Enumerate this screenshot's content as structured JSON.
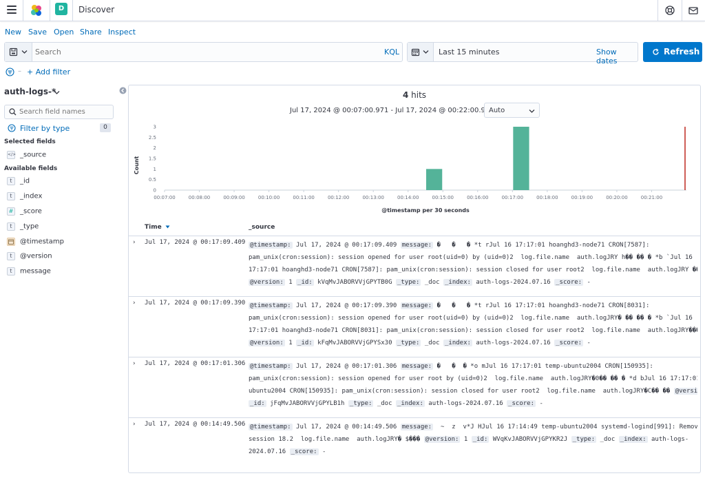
{
  "header": {
    "space_initial": "D",
    "app_title": "Discover"
  },
  "menu": {
    "items": [
      "New",
      "Save",
      "Open",
      "Share",
      "Inspect"
    ]
  },
  "query": {
    "placeholder": "Search",
    "language": "KQL"
  },
  "time": {
    "range": "Last 15 minutes",
    "show_dates": "Show dates",
    "refresh": "Refresh"
  },
  "filters": {
    "add": "+ Add filter"
  },
  "sidebar": {
    "index_pattern": "auth-logs-*",
    "search_placeholder": "Search field names",
    "filter_by_type": "Filter by type",
    "filter_count": "0",
    "selected_label": "Selected fields",
    "selected_fields": [
      {
        "type": "</>",
        "name": "_source"
      }
    ],
    "available_label": "Available fields",
    "available_fields": [
      {
        "type": "t",
        "name": "_id"
      },
      {
        "type": "t",
        "name": "_index"
      },
      {
        "type": "#",
        "name": "_score"
      },
      {
        "type": "t",
        "name": "_type"
      },
      {
        "type": "cal",
        "name": "@timestamp"
      },
      {
        "type": "t",
        "name": "@version"
      },
      {
        "type": "t",
        "name": "message"
      }
    ]
  },
  "results": {
    "hits_count": "4",
    "hits_label": "hits",
    "time_range": "Jul 17, 2024 @ 00:07:00.971 - Jul 17, 2024 @ 00:22:00.971",
    "interval": "Auto",
    "col_time": "Time",
    "col_source": "_source",
    "rows": [
      {
        "time": "Jul 17, 2024 @ 00:17:09.409",
        "lines": [
          [
            [
              "k",
              "@timestamp:"
            ],
            [
              "v",
              " Jul 17, 2024 @ 00:17:09.409 "
            ],
            [
              "k",
              "message:"
            ],
            [
              "v",
              " �   �   � *t rJul 16 17:17:01 hoanghd3-node71 CRON[7587]:"
            ]
          ],
          [
            [
              "v",
              "pam_unix(cron:session): session opened for user root(uid=0) by (uid=0)2  log.file.name  auth.logJRY h�� �� � *b `Jul 16"
            ]
          ],
          [
            [
              "v",
              "17:17:01 hoanghd3-node71 CRON[7587]: pam_unix(cron:session): session closed for user root2  log.file.name  auth.logJRY ��� ��"
            ]
          ],
          [
            [
              "k",
              "@version:"
            ],
            [
              "v",
              " 1 "
            ],
            [
              "k",
              "_id:"
            ],
            [
              "v",
              " kVqMvJABORVVjGPYTB0G "
            ],
            [
              "k",
              "_type:"
            ],
            [
              "v",
              " _doc "
            ],
            [
              "k",
              "_index:"
            ],
            [
              "v",
              " auth-logs-2024.07.16 "
            ],
            [
              "k",
              "_score:"
            ],
            [
              "v",
              " -"
            ]
          ]
        ]
      },
      {
        "time": "Jul 17, 2024 @ 00:17:09.390",
        "lines": [
          [
            [
              "k",
              "@timestamp:"
            ],
            [
              "v",
              " Jul 17, 2024 @ 00:17:09.390 "
            ],
            [
              "k",
              "message:"
            ],
            [
              "v",
              " �   �   � *t rJul 16 17:17:01 hoanghd3-node71 CRON[8031]:"
            ]
          ],
          [
            [
              "v",
              "pam_unix(cron:session): session opened for user root(uid=0) by (uid=0)2  log.file.name  auth.logJRY� �� �� � *b `Jul 16"
            ]
          ],
          [
            [
              "v",
              "17:17:01 hoanghd3-node71 CRON[8031]: pam_unix(cron:session): session closed for user root2  log.file.name  auth.logJRY���� ��"
            ]
          ],
          [
            [
              "k",
              "@version:"
            ],
            [
              "v",
              " 1 "
            ],
            [
              "k",
              "_id:"
            ],
            [
              "v",
              " kFqMvJABORVVjGPYSx30 "
            ],
            [
              "k",
              "_type:"
            ],
            [
              "v",
              " _doc "
            ],
            [
              "k",
              "_index:"
            ],
            [
              "v",
              " auth-logs-2024.07.16 "
            ],
            [
              "k",
              "_score:"
            ],
            [
              "v",
              " -"
            ]
          ]
        ]
      },
      {
        "time": "Jul 17, 2024 @ 00:17:01.306",
        "lines": [
          [
            [
              "k",
              "@timestamp:"
            ],
            [
              "v",
              " Jul 17, 2024 @ 00:17:01.306 "
            ],
            [
              "k",
              "message:"
            ],
            [
              "v",
              " �   �  � *o mJul 16 17:17:01 temp-ubuntu2004 CRON[150935]:"
            ]
          ],
          [
            [
              "v",
              "pam_unix(cron:session): session opened for user root by (uid=0)2  log.file.name  auth.logJRY�0�� �� � *d bJul 16 17:17:01 temp-"
            ]
          ],
          [
            [
              "v",
              "ubuntu2004 CRON[150935]: pam_unix(cron:session): session closed for user root2  log.file.name  auth.logJRY�C�� �� "
            ],
            [
              "k",
              "@version:"
            ],
            [
              "v",
              " 1"
            ]
          ],
          [
            [
              "k",
              "_id:"
            ],
            [
              "v",
              " jFqMvJABORVVjGPYLB1h "
            ],
            [
              "k",
              "_type:"
            ],
            [
              "v",
              " _doc "
            ],
            [
              "k",
              "_index:"
            ],
            [
              "v",
              " auth-logs-2024.07.16 "
            ],
            [
              "k",
              "_score:"
            ],
            [
              "v",
              " -"
            ]
          ]
        ]
      },
      {
        "time": "Jul 17, 2024 @ 00:14:49.506",
        "lines": [
          [
            [
              "k",
              "@timestamp:"
            ],
            [
              "v",
              " Jul 17, 2024 @ 00:14:49.506 "
            ],
            [
              "k",
              "message:"
            ],
            [
              "v",
              "  ~  z  v*J HJul 16 17:14:49 temp-ubuntu2004 systemd-logind[991]: Removed"
            ]
          ],
          [
            [
              "v",
              "session 18.2  log.file.name  auth.logJRY� $��� "
            ],
            [
              "k",
              "@version:"
            ],
            [
              "v",
              " 1 "
            ],
            [
              "k",
              "_id:"
            ],
            [
              "v",
              " WVqKvJABORVVjGPYKR2J "
            ],
            [
              "k",
              "_type:"
            ],
            [
              "v",
              " _doc "
            ],
            [
              "k",
              "_index:"
            ],
            [
              "v",
              " auth-logs-"
            ]
          ],
          [
            [
              "v",
              "2024.07.16 "
            ],
            [
              "k",
              "_score:"
            ],
            [
              "v",
              " -"
            ]
          ]
        ]
      }
    ]
  },
  "chart_data": {
    "type": "bar",
    "title": "",
    "xlabel": "@timestamp per 30 seconds",
    "ylabel": "Count",
    "x_ticks": [
      "00:07:00",
      "00:08:00",
      "00:09:00",
      "00:10:00",
      "00:11:00",
      "00:12:00",
      "00:13:00",
      "00:14:00",
      "00:15:00",
      "00:16:00",
      "00:17:00",
      "00:18:00",
      "00:19:00",
      "00:20:00",
      "00:21:00"
    ],
    "y_ticks": [
      "0",
      "0.5",
      "1",
      "1.5",
      "2",
      "2.5",
      "3"
    ],
    "ylim": [
      0,
      3
    ],
    "xlim": [
      "00:07:00",
      "00:22:00"
    ],
    "bars": [
      {
        "x": "00:14:30",
        "value": 1
      },
      {
        "x": "00:17:00",
        "value": 3
      }
    ],
    "now_marker": "00:22:00",
    "bar_color": "#54b399",
    "marker_color": "#bd271e",
    "grid": false
  }
}
